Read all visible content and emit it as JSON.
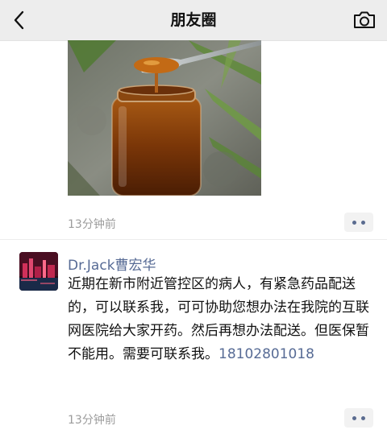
{
  "header": {
    "title": "朋友圈",
    "back_icon": "chevron-left-icon",
    "camera_icon": "camera-icon"
  },
  "post1": {
    "time": "13分钟前",
    "more_icon": "more-dots-icon"
  },
  "post2": {
    "username": "Dr.Jack曹宏华",
    "text": "近期在新市附近管控区的病人，有紧急药品配送的，可以联系我，可可协助您想办法在我院的互联网医院给大家开药。然后再想办法配送。但医保暂不能用。需要可联系我。",
    "phone": "18102801018",
    "time": "13分钟前",
    "more_icon": "more-dots-icon"
  },
  "colors": {
    "link": "#576b95",
    "nav_bg": "#ededed",
    "time": "#9c9c9c"
  }
}
